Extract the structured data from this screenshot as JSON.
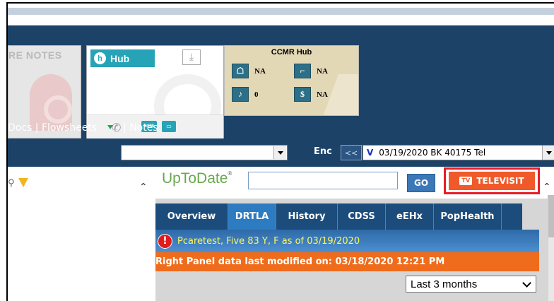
{
  "header": {
    "notes_tile": {
      "label": "RE NOTES"
    },
    "hub_tile": {
      "button_label": "Hub",
      "sms_label": "SMS"
    },
    "ccmr_tile": {
      "title": "CCMR Hub",
      "cells": [
        {
          "icon": "person-icon",
          "value": "NA"
        },
        {
          "icon": "stairs-icon",
          "value": "NA"
        },
        {
          "icon": "bell-icon",
          "value": "0"
        },
        {
          "icon": "dollar-icon",
          "value": "NA"
        }
      ]
    },
    "nav": {
      "docs": "Docs",
      "sep1": "|",
      "flowsheets": "Flowsheets",
      "sep2": "|",
      "notes": "Notes"
    },
    "enc": {
      "label": "Enc",
      "prev_label": "<<",
      "marker": "V",
      "value": "03/19/2020 BK 40175 Tel"
    }
  },
  "main": {
    "uptodate": {
      "logo": "UpToDate",
      "logo_mark": "®",
      "search_value": "",
      "go_label": "GO"
    },
    "televisit": {
      "label": "TELEVISIT",
      "icon_text": "TV"
    },
    "tabs": [
      {
        "label": "Overview",
        "active": false
      },
      {
        "label": "DRTLA",
        "active": true
      },
      {
        "label": "History",
        "active": false
      },
      {
        "label": "CDSS",
        "active": false
      },
      {
        "label": "eEHx",
        "active": false
      },
      {
        "label": "PopHealth",
        "active": false
      }
    ],
    "patient": {
      "alert": "!",
      "text": "Pcaretest, Five 83 Y, F as of 03/19/2020"
    },
    "modified": {
      "text": "Right Panel data last modified on: 03/18/2020 12:21 PM"
    },
    "range": {
      "selected": "Last 3 months"
    }
  },
  "colors": {
    "header_bg": "#1d4268",
    "tab_bar": "#1b4c7c",
    "tab_active": "#2d7bc1",
    "hub_teal": "#27a3b7",
    "ccmr_bg": "#e3d8b6",
    "televisit_orange": "#f05a2a",
    "modified_orange": "#ef6c1c",
    "patient_text": "#fff65a",
    "highlight_red": "#ea1b24"
  }
}
